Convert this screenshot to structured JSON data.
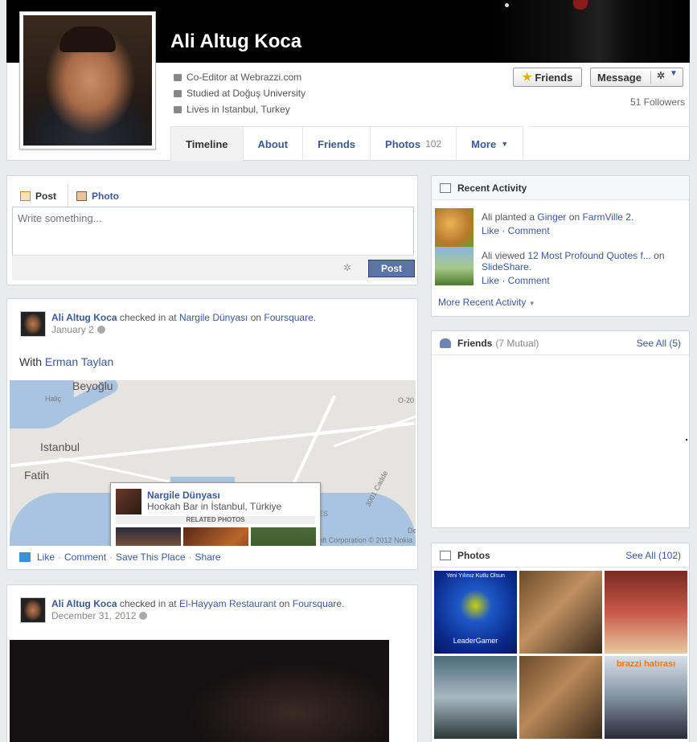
{
  "profile": {
    "name": "Ali Altug Koca",
    "work": "Co-Editor at Webrazzi.com",
    "study": "Studied at Doğuş University",
    "lives": "Lives in Istanbul, Turkey",
    "followers": "51 Followers"
  },
  "actions": {
    "friends_label": "Friends",
    "message_label": "Message"
  },
  "tabs": [
    {
      "label": "Timeline"
    },
    {
      "label": "About"
    },
    {
      "label": "Friends"
    },
    {
      "label": "Photos",
      "count": "102"
    },
    {
      "label": "More"
    }
  ],
  "composer": {
    "post_tab": "Post",
    "photo_tab": "Photo",
    "placeholder": "Write something...",
    "post_button": "Post"
  },
  "stories": [
    {
      "author": "Ali Altug Koca",
      "checked_in": "checked in at",
      "place": "Nargile Dünyası",
      "on": "on",
      "service": "Foursquare.",
      "date": "January 2",
      "with_label": "With",
      "with_person": "Erman Taylan",
      "map": {
        "labels": [
          "Beyoğlu",
          "Haliç",
          "Istanbul",
          "Fatih",
          "3001 Cadde",
          "O-20",
          "ES",
          "De"
        ],
        "copyright": "© 2013 Microsoft Corporation © 2012 Nokia",
        "popup_name": "Nargile Dünyası",
        "popup_desc": "Hookah Bar in İstanbul, Türkiye",
        "popup_related": "RELATED PHOTOS"
      },
      "actions": [
        "Like",
        "Comment",
        "Save This Place",
        "Share"
      ]
    },
    {
      "author": "Ali Altug Koca",
      "checked_in": "checked in at",
      "place": "El-Hayyam Restaurant",
      "on": "on",
      "service": "Foursquare.",
      "date": "December 31, 2012"
    }
  ],
  "recent_activity": {
    "title": "Recent Activity",
    "items": [
      {
        "prefix": "Ali planted a",
        "object": "Ginger",
        "mid": "on",
        "target": "FarmVille 2.",
        "actions": "Like · Comment"
      },
      {
        "prefix": "Ali viewed",
        "object": "12 Most Profound Quotes f...",
        "mid": "on",
        "target": "SlideShare.",
        "actions": "Like · Comment"
      }
    ],
    "more": "More Recent Activity"
  },
  "friends_box": {
    "title": "Friends",
    "sub": "(7 Mutual)",
    "see_all": "See All (5)"
  },
  "photos_box": {
    "title": "Photos",
    "see_all": "See All (102)",
    "photo1_top": "Yeni Yılınız Kutlu Olsun",
    "photo1_brand": "LeaderGamer",
    "photo6_text": "brazzi hatırası"
  },
  "icons": [
    "info-work-icon",
    "info-study-icon",
    "info-home-icon",
    "star-icon",
    "gear-icon",
    "chevron-down-icon",
    "globe-icon",
    "like-icon"
  ]
}
